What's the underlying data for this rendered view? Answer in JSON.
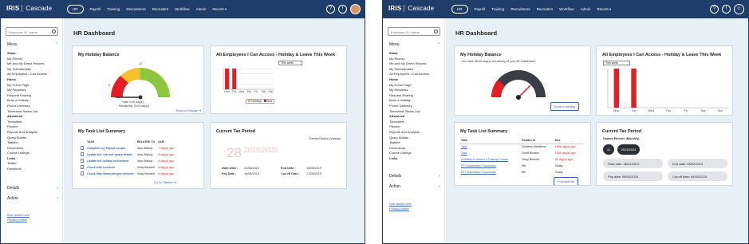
{
  "brand": {
    "logo": "IRIS",
    "app": "Cascade"
  },
  "nav": [
    "HR",
    "Payroll",
    "Training",
    "Recruitment",
    "Recruiters",
    "Workflow",
    "Admin",
    "Recent ▾"
  ],
  "top_icons": [
    "help-icon",
    "notifications-icon"
  ],
  "search_placeholder": "Employee ID, Name",
  "menu_label": "Menu",
  "menu_items": [
    {
      "label": "Shaw",
      "section": true
    },
    {
      "label": "My Record"
    },
    {
      "label": "Me and My Direct Reports"
    },
    {
      "label": "My Subordinates"
    },
    {
      "label": "All Employees I Can Access"
    },
    {
      "label": "Home",
      "section": true
    },
    {
      "label": "My Home Page"
    },
    {
      "label": "My Requests"
    },
    {
      "label": "Request Sharing"
    },
    {
      "label": "Book a Holiday"
    },
    {
      "label": "Phone Directory"
    },
    {
      "label": "Timesheet Status List"
    },
    {
      "label": "Advanced",
      "section": true
    },
    {
      "label": "Timesheet"
    },
    {
      "label": "Planner"
    },
    {
      "label": "Reports and Analysis"
    },
    {
      "label": "Query Builder"
    },
    {
      "label": "Taskflor"
    },
    {
      "label": "Documents"
    },
    {
      "label": "Course Listings"
    },
    {
      "label": "Links",
      "section": true
    },
    {
      "label": "Twitter"
    },
    {
      "label": "Facebook"
    }
  ],
  "side_sections": [
    "Details",
    "Action"
  ],
  "side_links": [
    "See what's new",
    "Privacy notice"
  ],
  "page_title": "HR Dashboard",
  "cards": {
    "holiday": "My Holiday Balance",
    "employees": "All Employees I Can Access - Holiday & Leave This Week",
    "tasks": "My Task List Summary",
    "tax": "Current Tax Period"
  },
  "old": {
    "gauge_max": "12",
    "gauge_mid": "6",
    "gauge_total": "Total: 0.00 day(s)",
    "gauge_remaining": "Remaining: 26.00 day(s)",
    "book_link": "Book a Holiday ➜",
    "week_select": "This week",
    "legend": [
      "Holidays",
      "Sick"
    ],
    "chart_days": [
      "Mon",
      "Tue",
      "Wed",
      "Thu",
      "Fri",
      "Sat",
      "Sun"
    ],
    "task_headers": [
      "TASK",
      "RELATED TO",
      "DUE"
    ],
    "tasks": [
      [
        "Complete my Payroll scripts",
        "John Bishop",
        "7 day(s) ago"
      ],
      [
        "Update the Job and salary details",
        "John Bishop",
        "8 day(s) ago"
      ],
      [
        "Update the holiday entitlement",
        "John Bishop",
        "8 day(s) ago"
      ],
      [
        "Check with Lumsure",
        "Vicky Bennett",
        "8 day(s) ago"
      ],
      [
        "Check http://www.bm.gov.uk/news",
        "Vicky Bennett",
        "8 day(s) ago"
      ]
    ],
    "task_link": "Go to Taskfor ➜",
    "company": "Dantes Electric (Weekly)",
    "period_num": "28",
    "period_year": "2019/2020",
    "start_label": "Start Date :",
    "start_val": "22/08/2019",
    "end_label": "End Date :",
    "end_val": "16/08/2019",
    "pay_label": "Pay Date :",
    "pay_val": "16/08/2019",
    "cutoff_label": "Cut off Date :",
    "cutoff_val": "17/08/2019"
  },
  "new": {
    "balance_text": "You have 26.00 day(s) remaining of your 26 entitlement",
    "book_btn": "Book a holiday",
    "week_select": "This week",
    "chart_days": [
      "Mon",
      "Tue",
      "Wed",
      "Thu",
      "Fri",
      "Sat",
      "Sun"
    ],
    "task_headers": [
      "Task",
      "Relates to",
      "Due"
    ],
    "tasks": [
      [
        "Task",
        "Geoffrey Middleton",
        "1456 day(s) ago"
      ],
      [
        "Task",
        "Geoff Browns",
        "1456 day(s) ago"
      ],
      [
        "Invitation to Attend a Training Course",
        "Vicky Bennett",
        "25 day(s) ago"
      ],
      [
        "RTI Submission Successful",
        "Me",
        "Today"
      ],
      [
        "RTI Submission Successful",
        "Me",
        "Today"
      ]
    ],
    "task_btn": "Full task list",
    "company": "Dantes Electric (Monthly)",
    "period_num": "11",
    "period_year": "2023/2024",
    "start": "Start date: 06/01/2024",
    "end": "End date: 05/02/2024",
    "pay": "Pay date: 06/02/2024",
    "cutoff": "Cut-off date: 04/02/2024"
  },
  "chart_data": [
    {
      "type": "bar",
      "categories": [
        "Mon",
        "Tue",
        "Wed",
        "Thu",
        "Fri",
        "Sat",
        "Sun"
      ],
      "series": [
        {
          "name": "Holidays",
          "values": [
            1,
            1,
            0,
            0,
            0,
            0,
            0
          ]
        }
      ],
      "ylim": [
        0,
        1
      ]
    },
    {
      "type": "bar",
      "categories": [
        "Mon",
        "Tue",
        "Wed",
        "Thu",
        "Fri",
        "Sat",
        "Sun"
      ],
      "series": [
        {
          "values": [
            1,
            1,
            0,
            0,
            0,
            0,
            0
          ]
        }
      ],
      "ylim": [
        0,
        1
      ]
    }
  ],
  "colors": {
    "topbar": "#1f3d6b",
    "accent": "#3a62b8",
    "bar": "#e31e24",
    "gauge_green": "#8cc63f",
    "gauge_dark": "#3a3f46"
  }
}
